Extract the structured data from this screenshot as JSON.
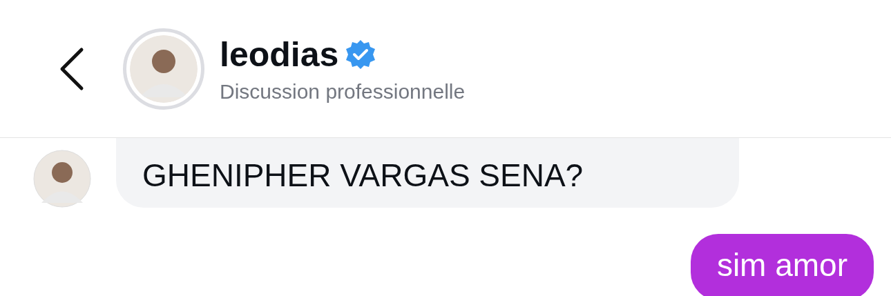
{
  "header": {
    "title": "leodias",
    "verified": true,
    "subtitle": "Discussion professionnelle"
  },
  "messages": [
    {
      "kind": "received",
      "text": "GHENIPHER VARGAS SENA?"
    },
    {
      "kind": "sent",
      "text": "sim amor"
    }
  ]
}
